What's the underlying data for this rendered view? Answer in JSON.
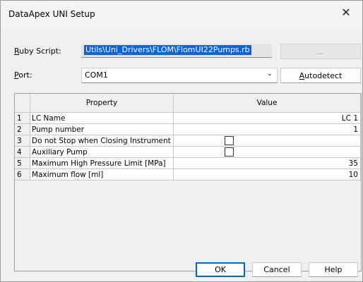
{
  "window": {
    "title": "DataApex UNI Setup",
    "close_glyph": "✕"
  },
  "ruby_script": {
    "label_accel": "R",
    "label_rest": "uby Script:",
    "value": "Utils\\Uni_Drivers\\FLOM\\FlomUI22Pumps.rb",
    "browse_label": "..."
  },
  "port": {
    "label_accel": "P",
    "label_rest": "ort:",
    "value": "COM1",
    "autodetect_accel": "A",
    "autodetect_rest": "utodetect"
  },
  "table": {
    "headers": {
      "property": "Property",
      "value": "Value"
    },
    "rows": [
      {
        "index": "1",
        "property": "LC Name",
        "value": "LC 1",
        "type": "text"
      },
      {
        "index": "2",
        "property": "Pump number",
        "value": "1",
        "type": "text"
      },
      {
        "index": "3",
        "property": "Do not Stop when Closing Instrument",
        "value": "",
        "type": "checkbox",
        "checked": false
      },
      {
        "index": "4",
        "property": "Auxiliary Pump",
        "value": "",
        "type": "checkbox",
        "checked": false
      },
      {
        "index": "5",
        "property": "Maximum High Pressure Limit [MPa]",
        "value": "35",
        "type": "text"
      },
      {
        "index": "6",
        "property": "Maximum flow [ml]",
        "value": "10",
        "type": "text"
      }
    ]
  },
  "buttons": {
    "ok": "OK",
    "cancel": "Cancel",
    "help": "Help"
  }
}
